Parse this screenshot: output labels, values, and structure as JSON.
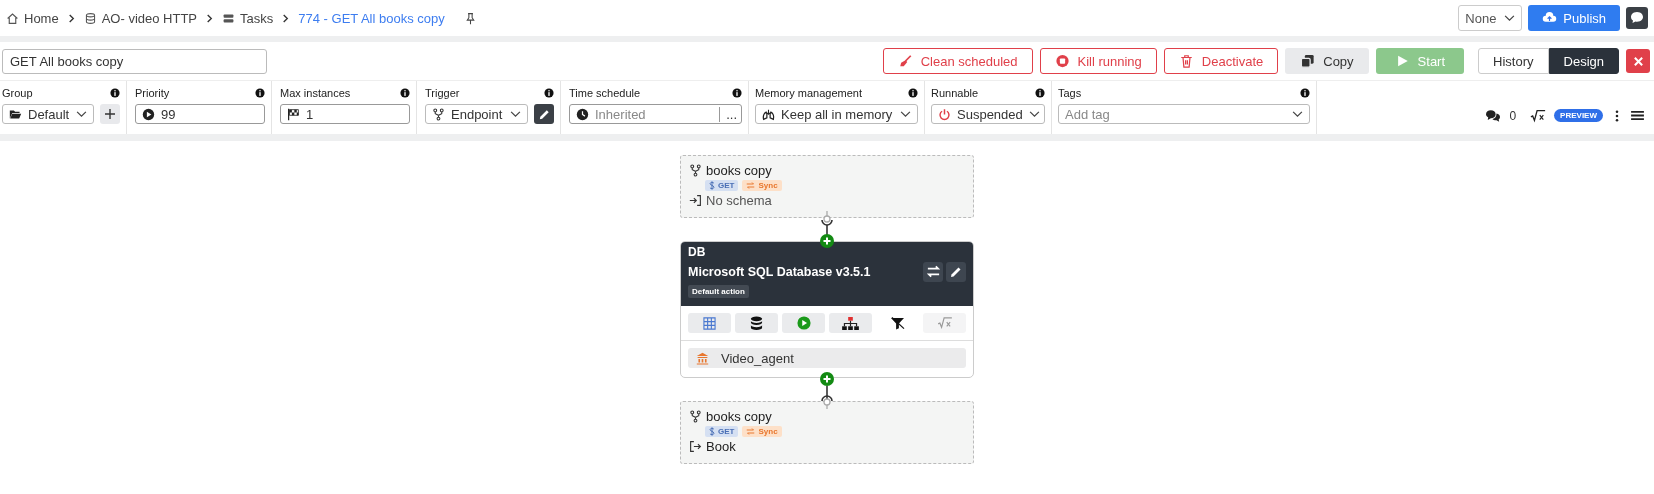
{
  "breadcrumb": [
    {
      "label": "Home",
      "current": false
    },
    {
      "label": "AO- video HTTP",
      "current": false
    },
    {
      "label": "Tasks",
      "current": false
    },
    {
      "label": "774 - GET All books copy",
      "current": true
    }
  ],
  "topbar": {
    "environment": "None",
    "publish": "Publish"
  },
  "task_name": "GET All books copy",
  "actions": [
    {
      "label": "Clean scheduled",
      "kind": "danger"
    },
    {
      "label": "Kill running",
      "kind": "danger"
    },
    {
      "label": "Deactivate",
      "kind": "danger"
    },
    {
      "label": "Copy",
      "kind": "secondary"
    },
    {
      "label": "Start",
      "kind": "success"
    }
  ],
  "view_tabs": [
    {
      "label": "History",
      "selected": false
    },
    {
      "label": "Design",
      "selected": true
    }
  ],
  "fields": [
    {
      "label": "Group",
      "kind": "select",
      "value": "Default"
    },
    {
      "label": "Priority",
      "kind": "input",
      "value": "99"
    },
    {
      "label": "Max instances",
      "kind": "input",
      "value": "1"
    },
    {
      "label": "Trigger",
      "kind": "select",
      "value": "Endpoint"
    },
    {
      "label": "Time schedule",
      "kind": "input",
      "placeholder": "Inherited",
      "button_text": "..."
    },
    {
      "label": "Memory management",
      "kind": "select",
      "value": "Keep all in memory"
    },
    {
      "label": "Runnable",
      "kind": "select",
      "value": "Suspended"
    },
    {
      "label": "Tags",
      "kind": "select",
      "placeholder": "Add tag"
    }
  ],
  "side_tools": {
    "comments": "0",
    "badge": "PREVIEW"
  },
  "flow": {
    "input_node": {
      "title": "books copy",
      "tags": [
        {
          "text": "GET",
          "kind": "method"
        },
        {
          "text": "Sync",
          "kind": "sync"
        }
      ],
      "footer": "No schema"
    },
    "step": {
      "type": "DB",
      "title": "Microsoft SQL Database v3.5.1",
      "badge": "Default action",
      "agent": "Video_agent"
    },
    "output_node": {
      "title": "books copy",
      "tags": [
        {
          "text": "GET",
          "kind": "method"
        },
        {
          "text": "Sync",
          "kind": "sync"
        }
      ],
      "footer": "Book"
    }
  }
}
